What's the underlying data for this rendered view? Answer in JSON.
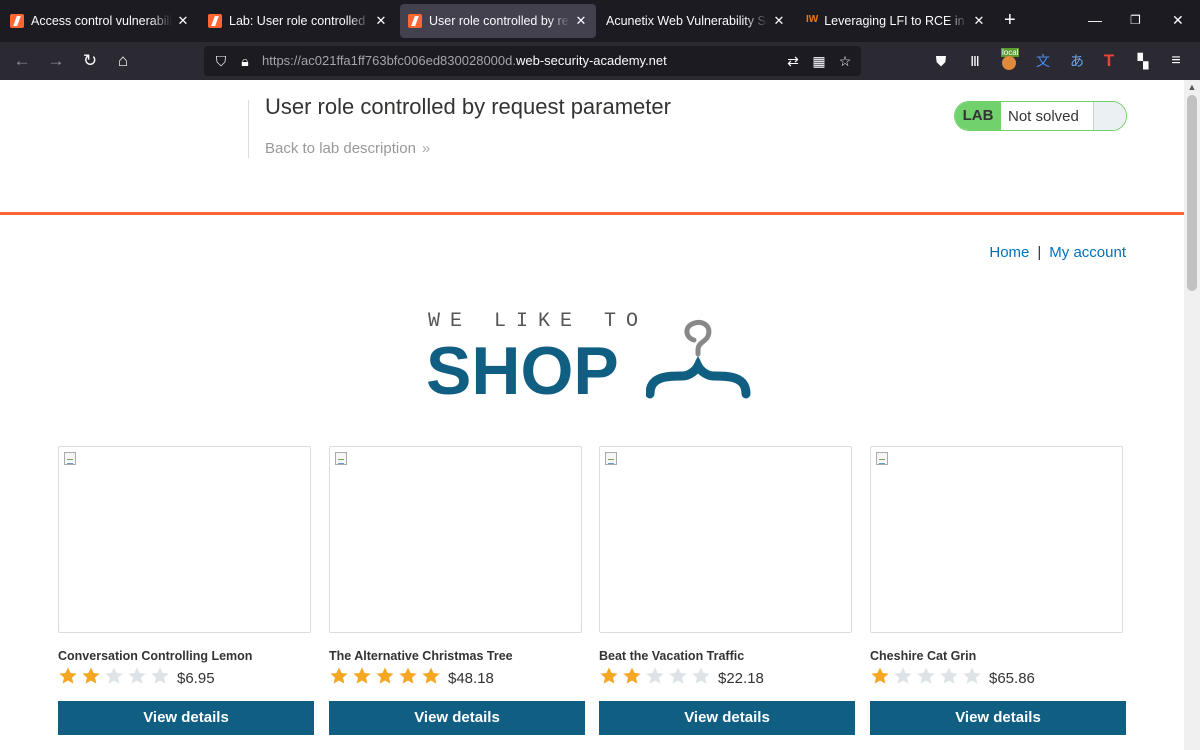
{
  "browser": {
    "tabs": [
      {
        "title": "Access control vulnerabilities",
        "favicon": "portswigger-icon",
        "active": false
      },
      {
        "title": "Lab: User role controlled by request parameter",
        "favicon": "portswigger-icon",
        "active": false
      },
      {
        "title": "User role controlled by request parameter",
        "favicon": "portswigger-icon",
        "active": true
      },
      {
        "title": "Acunetix Web Vulnerability Scanner",
        "favicon": "",
        "active": false
      },
      {
        "title": "Leveraging LFI to RCE in a website",
        "favicon": "iw",
        "active": false
      }
    ],
    "address": {
      "scheme": "https://ac021ffa1ff763bfc006ed830028000d.",
      "domain": "web-security-academy.net"
    },
    "badge_label": "local"
  },
  "lab": {
    "title": "User role controlled by request parameter",
    "back_link": "Back to lab description",
    "status_tag": "LAB",
    "status": "Not solved",
    "colors": {
      "accent": "#ff6633",
      "status_green": "#70d16d"
    }
  },
  "nav": {
    "home": "Home",
    "separator": "|",
    "account": "My account"
  },
  "logo": {
    "tagline": "WE LIKE TO",
    "brand": "SHOP",
    "brand_color": "#115e83"
  },
  "products": [
    {
      "name": "Conversation Controlling Lemon",
      "rating": 2,
      "price": "$6.95",
      "button": "View details"
    },
    {
      "name": "The Alternative Christmas Tree",
      "rating": 5,
      "price": "$48.18",
      "button": "View details"
    },
    {
      "name": "Beat the Vacation Traffic",
      "rating": 2,
      "price": "$22.18",
      "button": "View details"
    },
    {
      "name": "Cheshire Cat Grin",
      "rating": 1,
      "price": "$65.86",
      "button": "View details"
    }
  ],
  "star_colors": {
    "filled": "#f5a623",
    "empty": "#dde3e6"
  }
}
